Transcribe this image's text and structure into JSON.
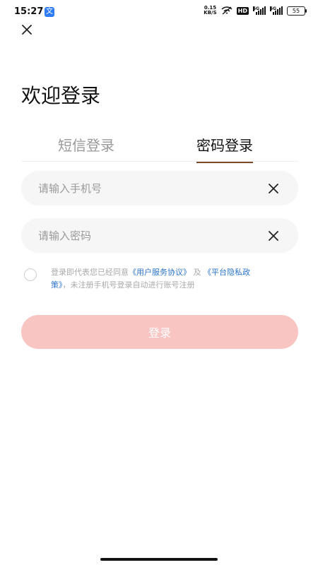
{
  "status_bar": {
    "time": "15:27",
    "app_badge": "文",
    "speed_value": "0.15",
    "speed_unit": "KB/S",
    "hd": "HD",
    "net1": "5G",
    "net2": "5G",
    "battery": "55"
  },
  "page": {
    "title": "欢迎登录"
  },
  "tabs": [
    {
      "label": "短信登录"
    },
    {
      "label": "密码登录"
    }
  ],
  "form": {
    "phone_placeholder": "请输入手机号",
    "password_placeholder": "请输入密码"
  },
  "agreement": {
    "prefix": "登录即代表您已经同意",
    "user_agreement": "《用户服务协议》",
    "conjunction": "及",
    "privacy_policy": "《平台隐私政策》",
    "suffix": "，未注册手机号登录自动进行账号注册"
  },
  "login_button": {
    "label": "登录"
  },
  "colors": {
    "accent_button": "#f9c5c3",
    "tab_underline": "#7b4a2b",
    "link": "#2b74c9"
  }
}
